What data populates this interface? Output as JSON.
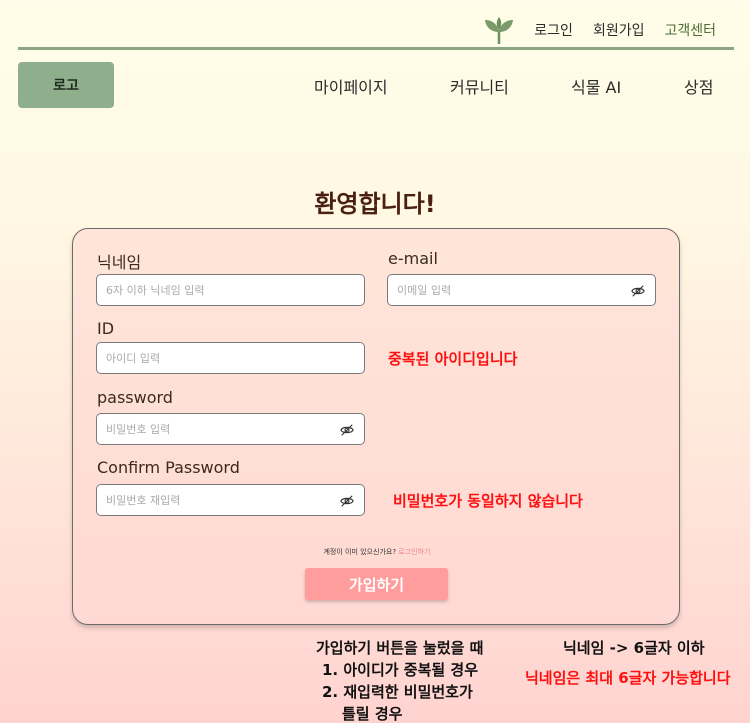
{
  "header": {
    "links": [
      {
        "label": "로그인"
      },
      {
        "label": "회원가입"
      },
      {
        "label": "고객센터"
      }
    ],
    "logo_button": "로고",
    "nav": [
      "마이페이지",
      "커뮤니티",
      "식물 AI",
      "상점"
    ]
  },
  "page": {
    "title": "환영합니다!"
  },
  "form": {
    "nickname": {
      "label": "닉네임",
      "placeholder": "6자 이하 닉네임 입력"
    },
    "email": {
      "label": "e-mail",
      "placeholder": "이메일 입력"
    },
    "id": {
      "label": "ID",
      "placeholder": "아이디 입력",
      "error": "중복된 아이디입니다"
    },
    "password": {
      "label": "password",
      "placeholder": "비밀번호 입력"
    },
    "confirm": {
      "label": "Confirm Password",
      "placeholder": "비밀번호 재입력",
      "error": "비밀번호가 동일하지 않습니다"
    },
    "already_text": "계정이 이미 있으신가요?",
    "login_link": "로그인하기",
    "submit": "가입하기"
  },
  "notes": {
    "condition_title": "가입하기 버튼을 눌렀을 때",
    "condition_1": "1. 아이디가 중복될 경우",
    "condition_2a": "2. 재입력한 비밀번호가",
    "condition_2b": "틀릴 경우",
    "nickname_rule": "닉네임 -> 6글자 이하",
    "nickname_error": "닉네임은 최대 6글자 가능합니다"
  },
  "colors": {
    "brand_green": "#8fae8c",
    "error_red": "#ff1010",
    "submit_pink": "#ff9c9c",
    "active_link": "#4e6d36"
  },
  "icons": {
    "logo": "sprout-icon",
    "password_toggle": "eye-slash-icon"
  }
}
